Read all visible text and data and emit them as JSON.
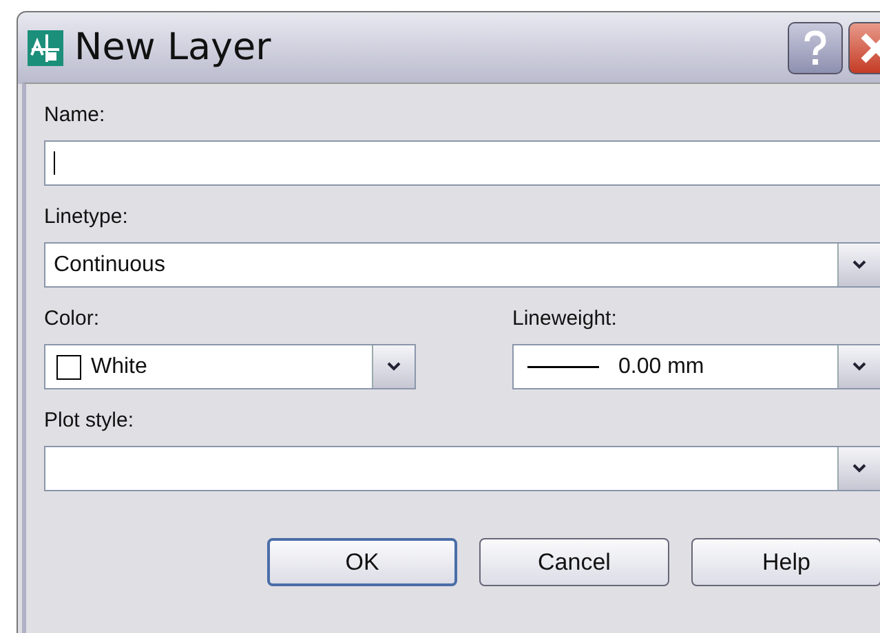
{
  "window": {
    "title": "New Layer"
  },
  "fields": [
    {
      "kind": "text",
      "label": "Name:"
    },
    {
      "kind": "dropdown",
      "label": "Linetype:",
      "value": "Continuous"
    },
    {
      "kind": "color",
      "label": "Color:",
      "value": "White"
    },
    {
      "kind": "lineweight",
      "label": "Lineweight:",
      "value": "0.00 mm"
    },
    {
      "kind": "dropdown",
      "label": "Plot style:"
    }
  ],
  "buttons": [
    {
      "label": "OK",
      "default": true
    },
    {
      "label": "Cancel",
      "default": false
    },
    {
      "label": "Help",
      "default": false
    }
  ]
}
